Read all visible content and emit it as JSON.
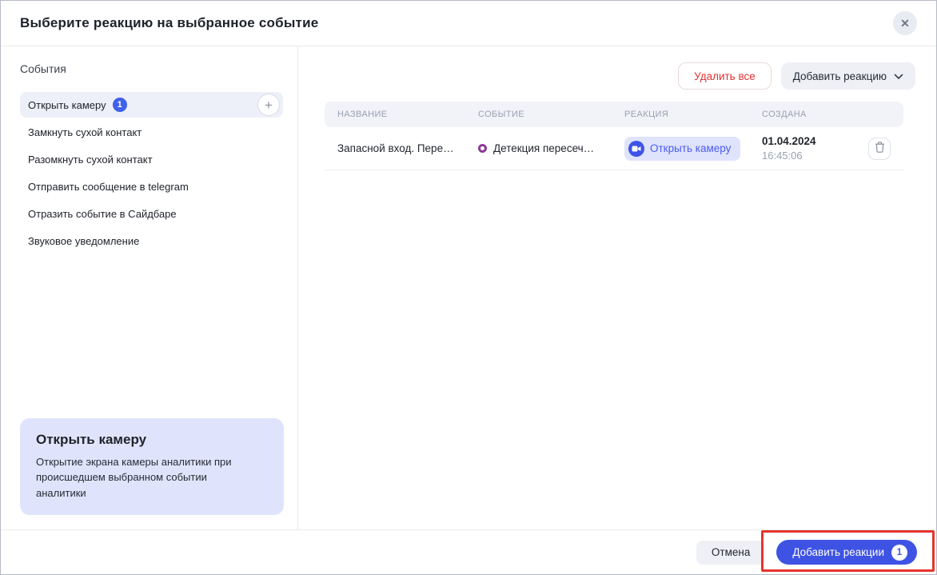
{
  "modal": {
    "title": "Выберите реакцию на выбранное событие"
  },
  "sidebar": {
    "heading": "События",
    "items": [
      {
        "label": "Открыть камеру",
        "badge": "1"
      },
      {
        "label": "Замкнуть сухой контакт"
      },
      {
        "label": "Разомкнуть сухой контакт"
      },
      {
        "label": "Отправить сообщение в telegram"
      },
      {
        "label": "Отразить событие в Сайдбаре"
      },
      {
        "label": "Звуковое уведомление"
      }
    ],
    "info_card": {
      "title": "Открыть камеру",
      "description": "Открытие экрана камеры аналитики при происшедшем выбранном событии аналитики"
    }
  },
  "toolbar": {
    "delete_all_label": "Удалить все",
    "add_reaction_label": "Добавить реакцию"
  },
  "table": {
    "headers": [
      "НАЗВАНИЕ",
      "СОБЫТИЕ",
      "РЕАКЦИЯ",
      "СОЗДАНА"
    ],
    "rows": [
      {
        "name": "Запасной вход. Пере…",
        "event": "Детекция пересеч…",
        "reaction": "Открыть камеру",
        "created_date": "01.04.2024",
        "created_time": "16:45:06"
      }
    ]
  },
  "footer": {
    "cancel_label": "Отмена",
    "submit_label": "Добавить реакции",
    "submit_badge": "1"
  },
  "icons": {
    "close": "✕",
    "plus": "+"
  },
  "colors": {
    "primary_blue": "#3e53e4",
    "badge_blue": "#4061e8",
    "chip_bg": "#dfe3fb",
    "chip_text": "#4b5cf0",
    "selected_item_bg": "#eef0f9",
    "info_card_bg": "#dfe4fc",
    "danger_red": "#e03131",
    "annotation_red": "#e5342e",
    "event_ring_purple": "#8d3a96"
  }
}
